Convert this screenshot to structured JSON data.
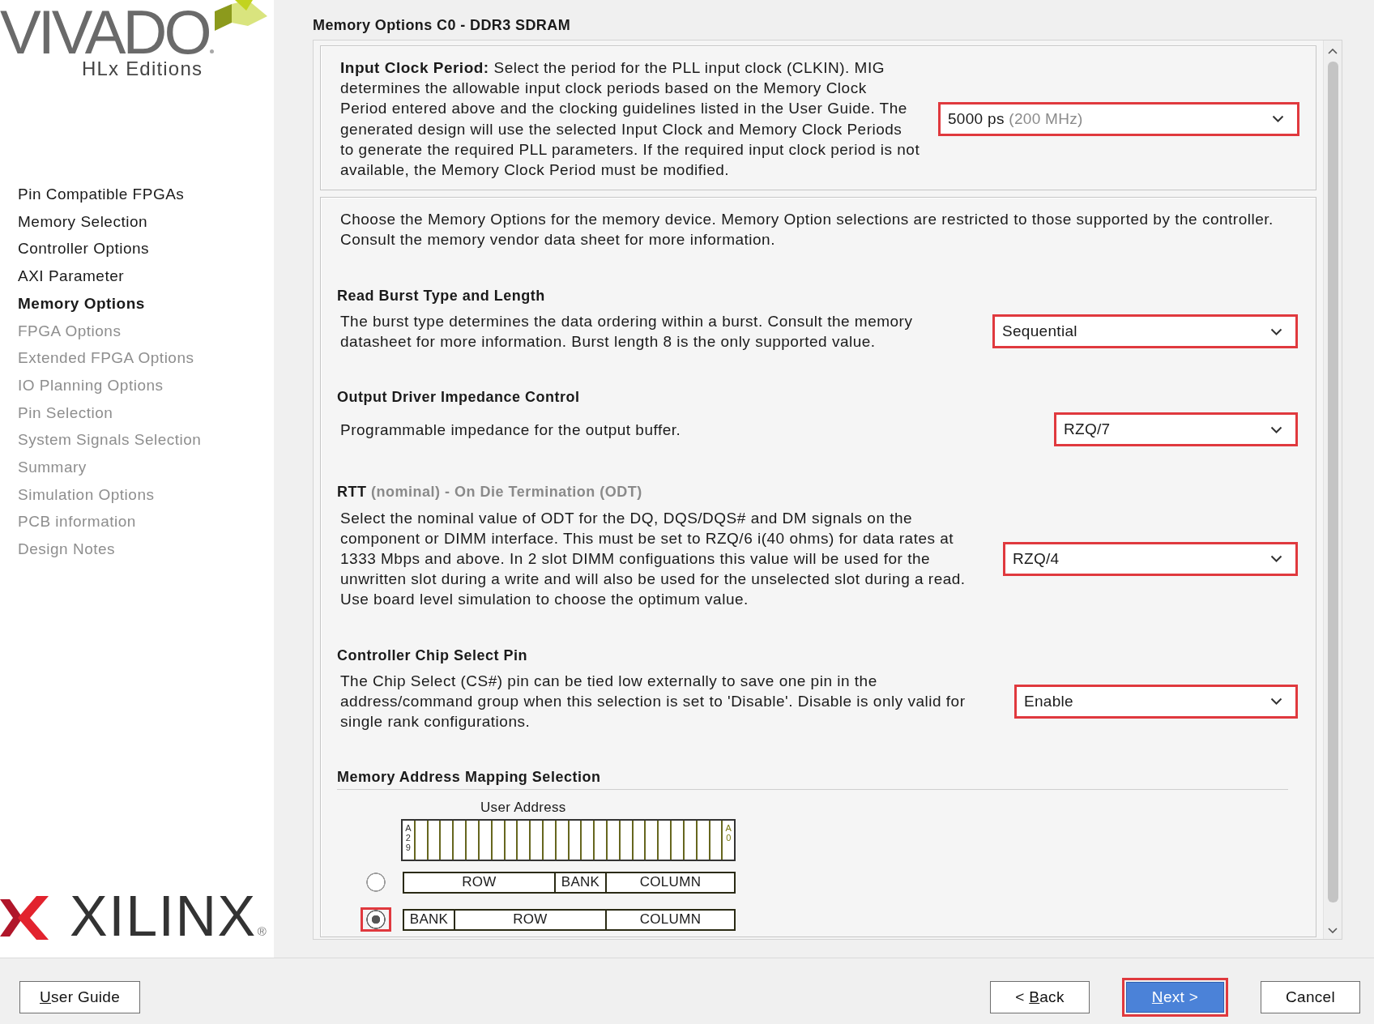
{
  "branding": {
    "product": "VIVADO",
    "edition": "HLx Editions",
    "vendor": "XILINX",
    "vendor_mark": "®"
  },
  "steps": [
    {
      "label": "Pin Compatible FPGAs",
      "selected": false,
      "disabled": false
    },
    {
      "label": "Memory Selection",
      "selected": false,
      "disabled": false
    },
    {
      "label": "Controller Options",
      "selected": false,
      "disabled": false
    },
    {
      "label": "AXI Parameter",
      "selected": false,
      "disabled": false
    },
    {
      "label": "Memory Options",
      "selected": true,
      "disabled": false
    },
    {
      "label": "FPGA Options",
      "selected": false,
      "disabled": true
    },
    {
      "label": "Extended FPGA Options",
      "selected": false,
      "disabled": true
    },
    {
      "label": "IO Planning Options",
      "selected": false,
      "disabled": true
    },
    {
      "label": "Pin Selection",
      "selected": false,
      "disabled": true
    },
    {
      "label": "System Signals Selection",
      "selected": false,
      "disabled": true
    },
    {
      "label": "Summary",
      "selected": false,
      "disabled": true
    },
    {
      "label": "Simulation Options",
      "selected": false,
      "disabled": true
    },
    {
      "label": "PCB information",
      "selected": false,
      "disabled": true
    },
    {
      "label": "Design Notes",
      "selected": false,
      "disabled": true
    }
  ],
  "page_title": "Memory Options C0 - DDR3 SDRAM",
  "input_clock_period": {
    "description": "**Input Clock Period:** Select the period for the PLL input clock (CLKIN). MIG\ndetermines the allowable input clock periods based on the Memory Clock\nPeriod entered above and the clocking guidelines listed in the User Guide. The\ngenerated design will use the selected Input Clock and Memory Clock Periods\nto generate the required PLL parameters. If the required input clock period is not\navailable, the Memory Clock Period must be modified.",
    "dropdown": {
      "value": "5000 ps",
      "note": "(200 MHz)",
      "highlighted": true
    }
  },
  "memory_options": {
    "intro": "Choose the Memory Options for the memory device. Memory Option selections are restricted to those supported by the controller.\nConsult the memory vendor data sheet for more information.",
    "options": [
      {
        "title": "Read Burst Type and Length",
        "description": "The burst type determines the data ordering within a burst. Consult the memory\ndatasheet for more information. Burst length 8 is the only supported value.",
        "dropdown": {
          "value": "Sequential",
          "highlighted": true
        }
      },
      {
        "title": "Output Driver Impedance Control",
        "description": "Programmable impedance for the output buffer.",
        "dropdown": {
          "value": "RZQ/7",
          "highlighted": true
        }
      },
      {
        "title": "RTT",
        "subtitle": "(nominal) - On Die Termination (ODT)",
        "description": "Select the nominal value of ODT for the DQ, DQS/DQS# and DM signals on the\ncomponent or DIMM interface. This must be set to RZQ/6 i(40 ohms) for data rates at\n1333 Mbps and above. In 2 slot DIMM configuations this value will be used for the\nunwritten slot during a write and will also be used for the unselected slot during a read.\nUse board level simulation to choose the optimum value.",
        "dropdown": {
          "value": "RZQ/4",
          "highlighted": true
        }
      },
      {
        "title": "Controller Chip Select Pin",
        "description": "The Chip Select (CS#) pin can be tied low externally to save one pin in the\naddress/command group when this selection is set to 'Disable'. Disable is only valid for\nsingle rank configurations.",
        "dropdown": {
          "value": "Enable",
          "highlighted": true
        }
      }
    ]
  },
  "address_mapping": {
    "title": "Memory Address Mapping Selection",
    "user_address_label": "User Address",
    "msb_label": "A29",
    "lsb_label": "A0",
    "options": [
      {
        "selected": false,
        "highlighted": false,
        "fields": [
          {
            "kind": "row",
            "label": "ROW"
          },
          {
            "kind": "bank",
            "label": "BANK"
          },
          {
            "kind": "column",
            "label": "COLUMN"
          }
        ]
      },
      {
        "selected": true,
        "highlighted": true,
        "fields": [
          {
            "kind": "bank",
            "label": "BANK"
          },
          {
            "kind": "row",
            "label": "ROW"
          },
          {
            "kind": "column",
            "label": "COLUMN"
          }
        ]
      }
    ]
  },
  "footer": {
    "left_buttons": [
      {
        "label": "User Guide",
        "mnemonic": true,
        "primary": false,
        "highlighted": false
      }
    ],
    "right_buttons": [
      {
        "label": "< Back",
        "mnemonic": true,
        "primary": false,
        "highlighted": false
      },
      {
        "label": "Next >",
        "mnemonic": true,
        "primary": true,
        "highlighted": true
      },
      {
        "label": "Cancel",
        "mnemonic": false,
        "primary": false,
        "highlighted": false
      }
    ]
  }
}
